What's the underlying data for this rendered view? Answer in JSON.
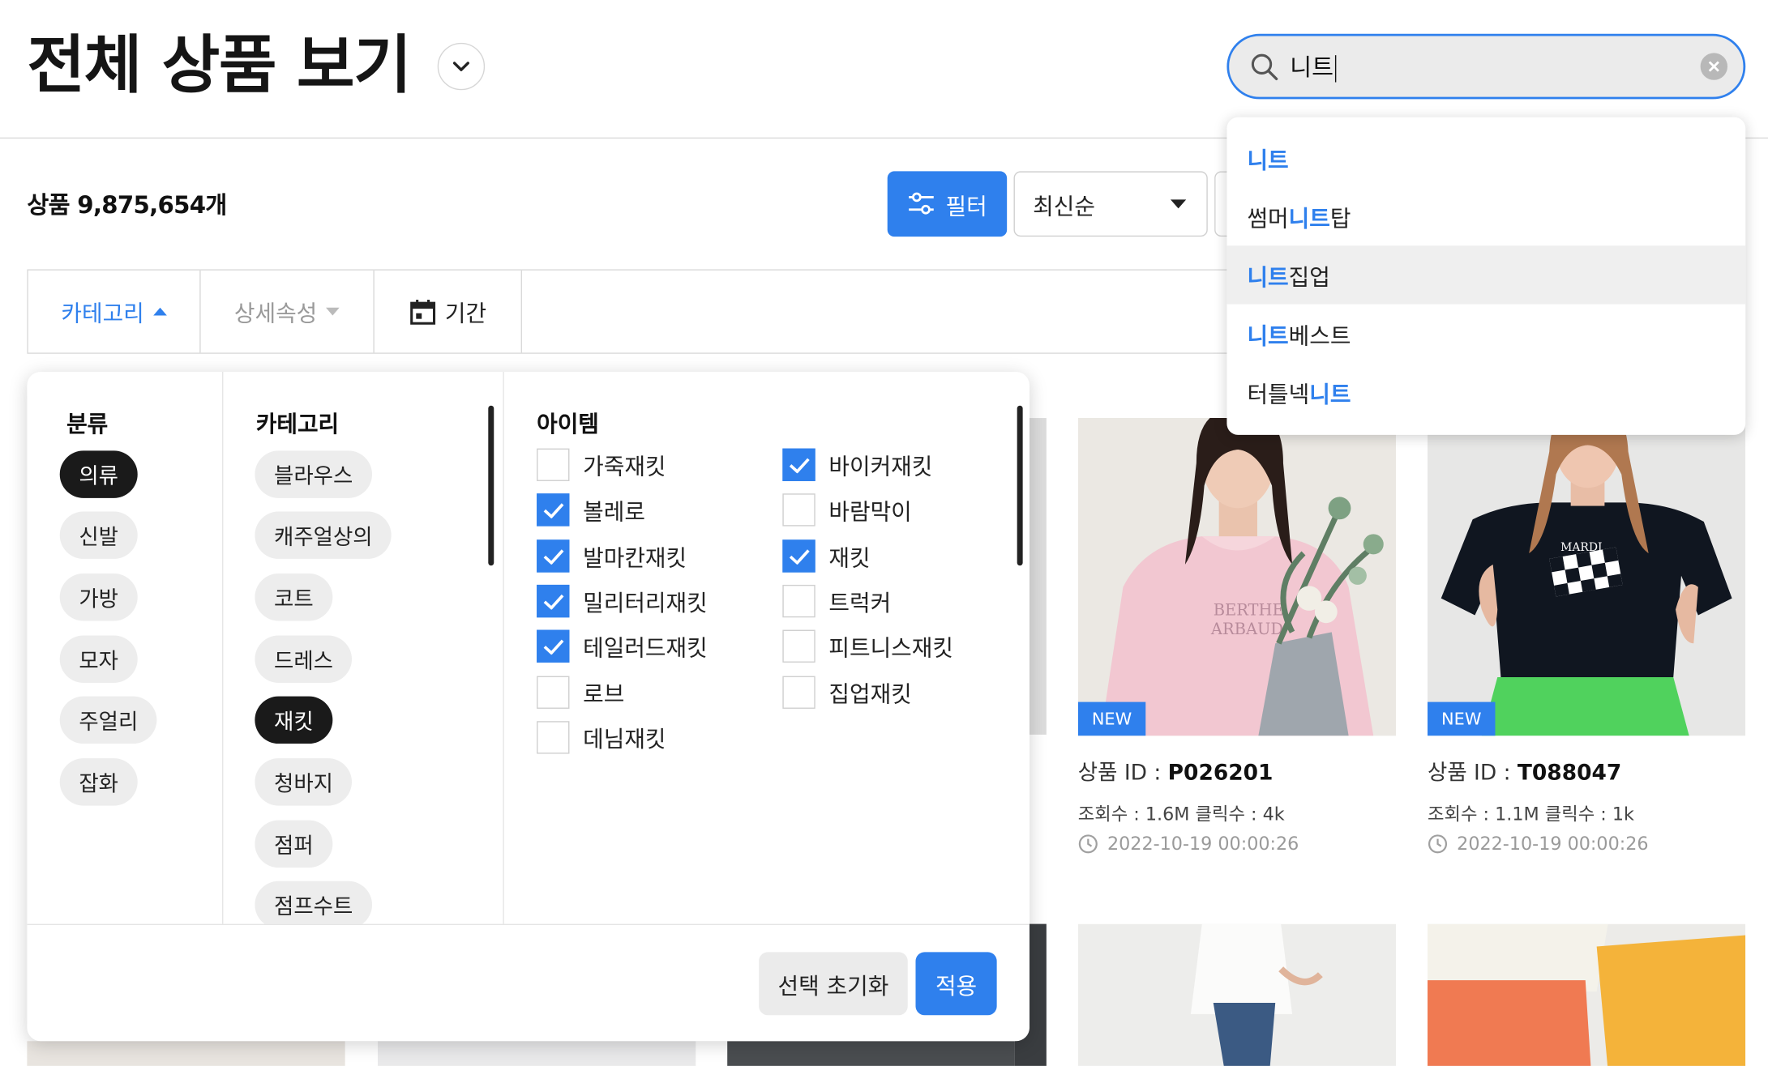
{
  "header": {
    "title": "전체 상품 보기"
  },
  "search": {
    "query": "니트"
  },
  "suggestions": [
    {
      "match": "니트",
      "rest": "",
      "before": ""
    },
    {
      "before": "썸머",
      "match": "니트",
      "rest": "탑"
    },
    {
      "before": "",
      "match": "니트",
      "rest": "집업"
    },
    {
      "before": "",
      "match": "니트",
      "rest": "베스트"
    },
    {
      "before": "터틀넥",
      "match": "니트",
      "rest": ""
    }
  ],
  "summary": {
    "count_text": "상품 9,875,654개"
  },
  "toolbar": {
    "filter_label": "필터",
    "sort_label": "최신순"
  },
  "tabs": {
    "category": "카테고리",
    "detail": "상세속성",
    "period": "기간"
  },
  "filter_panel": {
    "col1_title": "분류",
    "classes": [
      "의류",
      "신발",
      "가방",
      "모자",
      "주얼리",
      "잡화"
    ],
    "col2_title": "카테고리",
    "categories": [
      "블라우스",
      "캐주얼상의",
      "코트",
      "드레스",
      "재킷",
      "청바지",
      "점퍼",
      "점프수트"
    ],
    "col3_title": "아이템",
    "items_left": [
      "가죽재킷",
      "볼레로",
      "발마칸재킷",
      "밀리터리재킷",
      "테일러드재킷",
      "로브",
      "데님재킷"
    ],
    "items_right": [
      "바이커재킷",
      "바람막이",
      "재킷",
      "트럭커",
      "피트니스재킷",
      "집업재킷"
    ],
    "reset_label": "선택 초기화",
    "apply_label": "적용"
  },
  "products": [
    {
      "badge": "NEW",
      "id_label": "상품 ID : ",
      "id": "P026201",
      "stats": "조회수 : 1.6M   클릭수 : 4k",
      "date": "2022-10-19 00:00:26"
    },
    {
      "badge": "NEW",
      "id_label": "상품 ID : ",
      "id": "T088047",
      "stats": "조회수 : 1.1M   클릭수 : 1k",
      "date": "2022-10-19 00:00:26"
    }
  ],
  "colors": {
    "accent": "#2f80ed",
    "selected_chip": "#1a1a1a"
  }
}
